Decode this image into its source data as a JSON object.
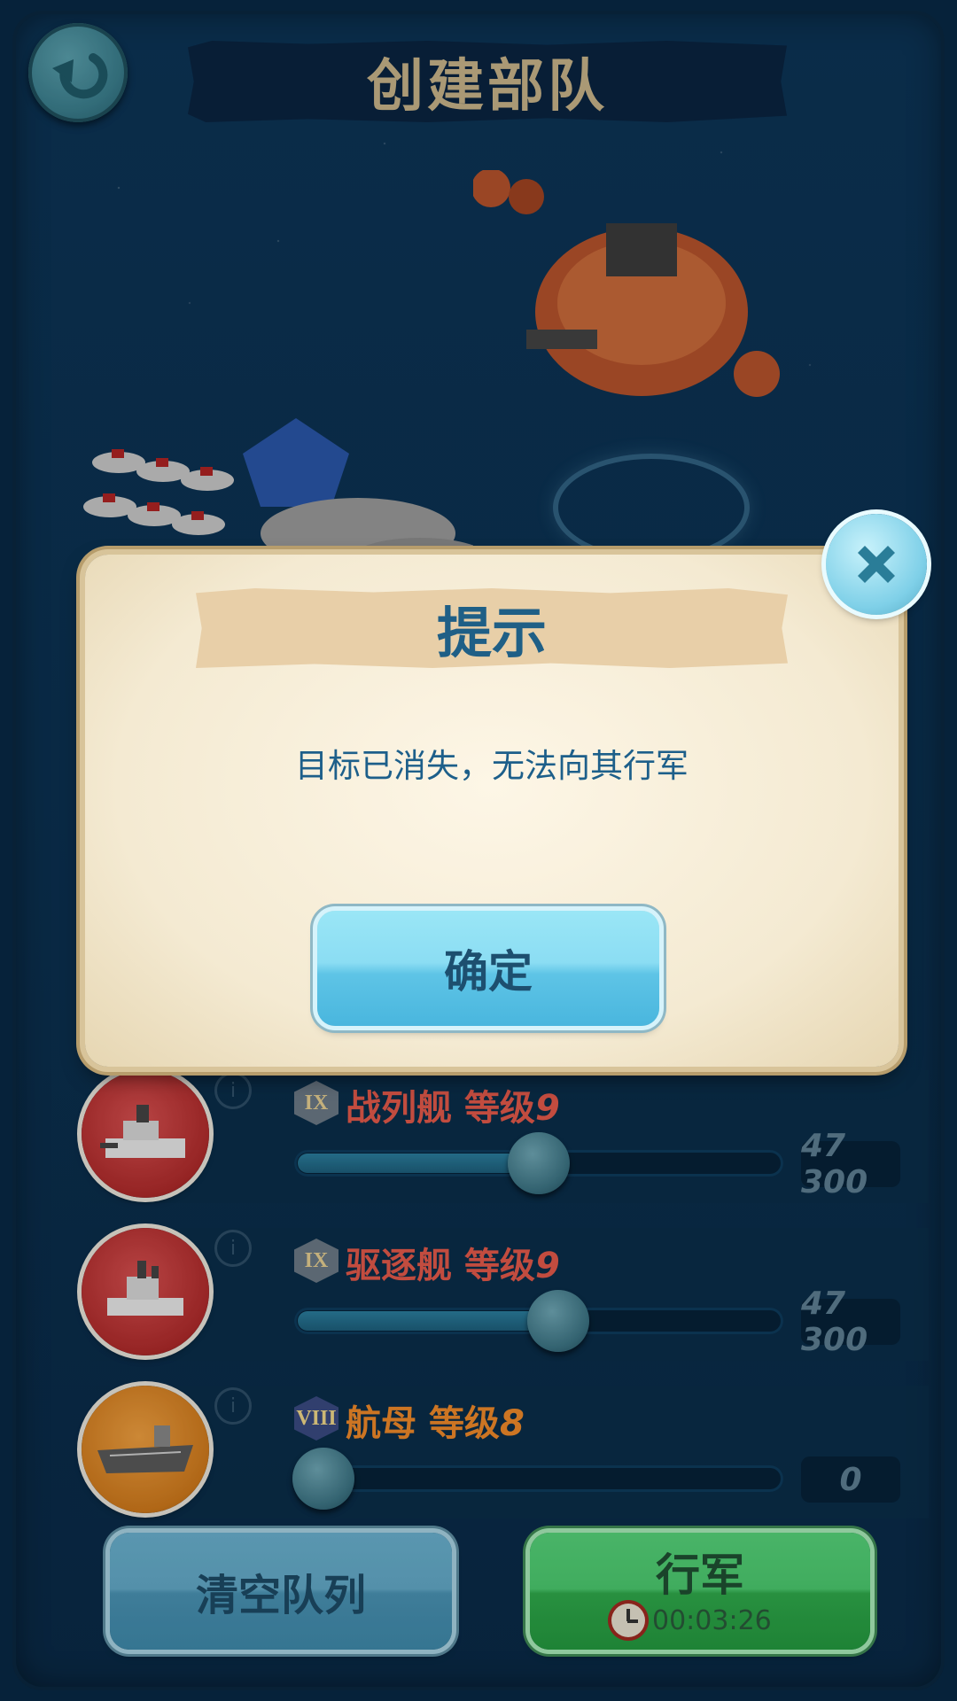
{
  "header": {
    "title": "创建部队"
  },
  "dialog": {
    "title": "提示",
    "message": "目标已消失，无法向其行军",
    "confirm_label": "确定"
  },
  "units": [
    {
      "tier": "IX",
      "name": "战列舰",
      "level_label": "等级",
      "level": "9",
      "slider_fraction": 0.5,
      "count": "47 300",
      "color": "#e45a4a"
    },
    {
      "tier": "IX",
      "name": "驱逐舰",
      "level_label": "等级",
      "level": "9",
      "slider_fraction": 0.54,
      "count": "47 300",
      "color": "#e45a4a"
    },
    {
      "tier": "VIII",
      "name": "航母",
      "level_label": "等级",
      "level": "8",
      "slider_fraction": 0.0,
      "count": "0",
      "color": "#f08a2a"
    }
  ],
  "footer": {
    "clear_label": "清空队列",
    "march_label": "行军",
    "march_time": "00:03:26"
  },
  "icons": [
    "back-arrow-icon",
    "close-x-icon",
    "info-icon",
    "clock-icon"
  ]
}
